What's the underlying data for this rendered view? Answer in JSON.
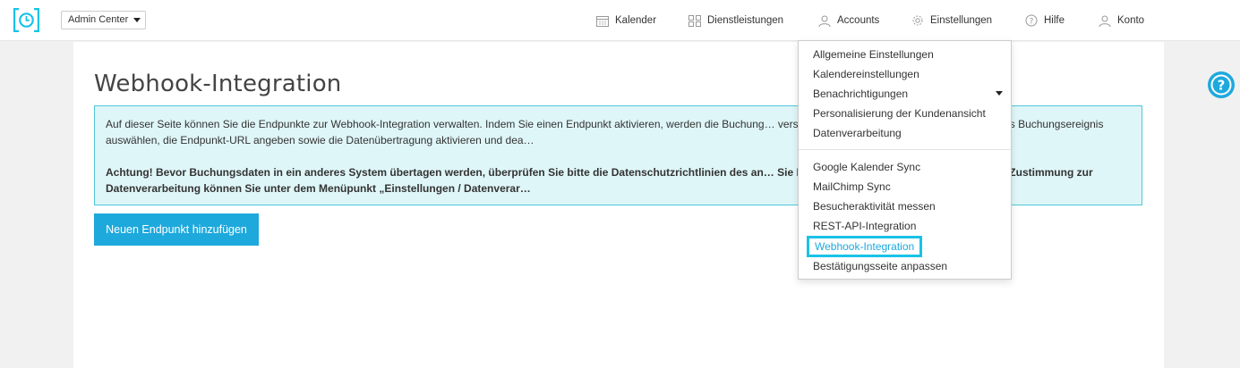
{
  "header": {
    "admin_select": "Admin Center",
    "nav": {
      "kalender": "Kalender",
      "dienstleistungen": "Dienstleistungen",
      "accounts": "Accounts",
      "einstellungen": "Einstellungen",
      "hilfe": "Hilfe",
      "konto": "Konto"
    }
  },
  "page": {
    "title": "Webhook-Integration",
    "info_text": "Auf dieser Seite können Sie die Endpunkte zur Webhook-Integration verwalten. Indem Sie einen Endpunkt aktivieren, werden die Buchung… versendet. In dem Popup-Fenster können Sie das Buchungsereignis auswählen, die Endpunkt-URL angeben sowie die Datenübertragung aktivieren und dea…",
    "warning_text": "Achtung! Bevor Buchungsdaten in ein anderes System übertagen werden, überprüfen Sie bitte die Datenschutzrichtlinien des an… Sie Ihre Kunden entsprechend. (Den Text der Zustimmung zur Datenverarbeitung können Sie unter dem Menüpunkt „Einstellungen / Datenverar…",
    "add_button": "Neuen Endpunkt hinzufügen"
  },
  "dropdown": {
    "group1": [
      "Allgemeine Einstellungen",
      "Kalendereinstellungen",
      "Benachrichtigungen",
      "Personalisierung der Kundenansicht",
      "Datenverarbeitung"
    ],
    "group2": [
      "Google Kalender Sync",
      "MailChimp Sync",
      "Besucheraktivität messen",
      "REST-API-Integration",
      "Webhook-Integration",
      "Bestätigungsseite anpassen"
    ],
    "active_item": "Webhook-Integration"
  },
  "colors": {
    "accent": "#1ea9dd",
    "highlight_border": "#19c2e8",
    "info_bg": "#dff6f8",
    "info_border": "#4fc7d9"
  }
}
